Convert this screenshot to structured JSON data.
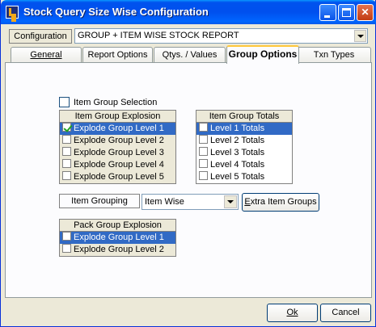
{
  "window": {
    "title": "Stock Query Size Wise Configuration"
  },
  "config": {
    "label": "Configuration",
    "value": "GROUP + ITEM WISE STOCK REPORT"
  },
  "tabs": [
    {
      "label": "General",
      "active": false
    },
    {
      "label": "Report Options",
      "active": false
    },
    {
      "label": "Qtys. / Values",
      "active": false
    },
    {
      "label": "Group Options",
      "active": true
    },
    {
      "label": "Txn Types",
      "active": false
    }
  ],
  "item_group_selection": {
    "label": "Item Group Selection",
    "checked": false
  },
  "item_group_explosion": {
    "title": "Item Group Explosion",
    "items": [
      {
        "label": "Explode Group Level 1",
        "checked": true,
        "selected": true
      },
      {
        "label": "Explode Group Level 2",
        "checked": false,
        "selected": false
      },
      {
        "label": "Explode Group Level 3",
        "checked": false,
        "selected": false
      },
      {
        "label": "Explode Group Level 4",
        "checked": false,
        "selected": false
      },
      {
        "label": "Explode Group Level 5",
        "checked": false,
        "selected": false
      }
    ]
  },
  "item_group_totals": {
    "title": "Item Group Totals",
    "items": [
      {
        "label": "Level 1 Totals",
        "checked": false,
        "selected": true
      },
      {
        "label": "Level 2 Totals",
        "checked": false,
        "selected": false
      },
      {
        "label": "Level 3 Totals",
        "checked": false,
        "selected": false
      },
      {
        "label": "Level 4 Totals",
        "checked": false,
        "selected": false
      },
      {
        "label": "Level 5 Totals",
        "checked": false,
        "selected": false
      }
    ]
  },
  "item_grouping": {
    "label": "Item Grouping",
    "value": "Item Wise"
  },
  "extra_item_groups_button": {
    "label": "Extra Item Groups"
  },
  "pack_group_explosion": {
    "title": "Pack Group Explosion",
    "items": [
      {
        "label": "Explode Group Level 1",
        "checked": false,
        "selected": true
      },
      {
        "label": "Explode Group Level 2",
        "checked": false,
        "selected": false
      }
    ]
  },
  "buttons": {
    "ok": "Ok",
    "cancel": "Cancel"
  }
}
